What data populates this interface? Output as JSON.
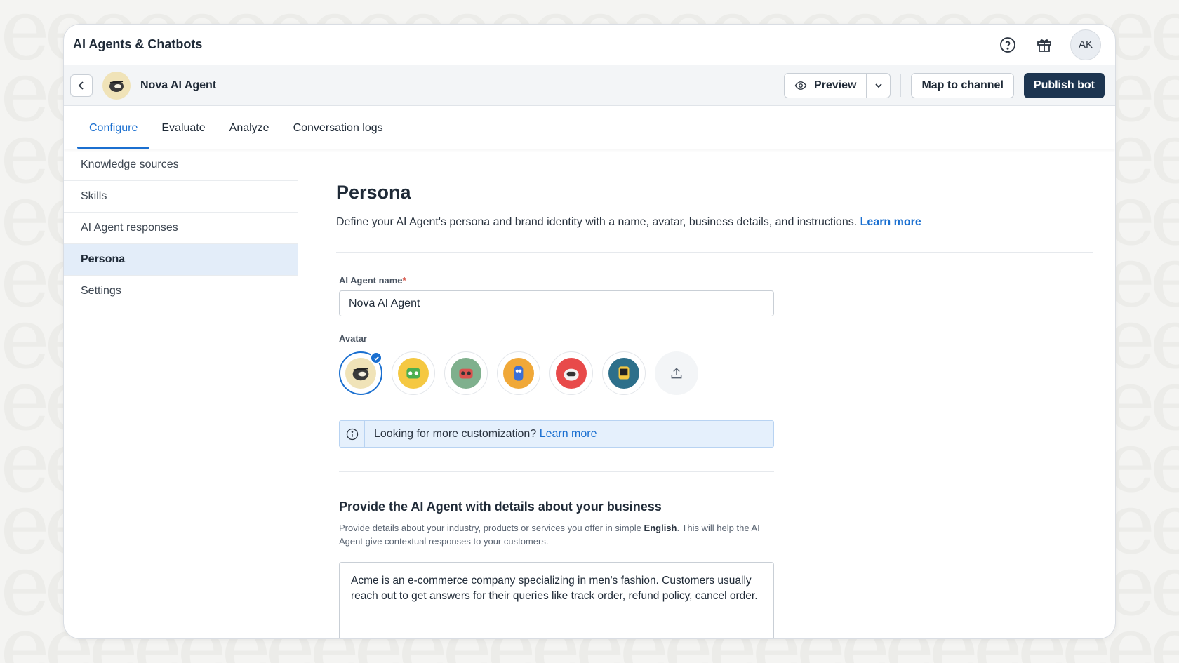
{
  "header": {
    "app_title": "AI Agents & Chatbots",
    "user_initials": "AK"
  },
  "bot": {
    "name": "Nova AI Agent",
    "preview_label": "Preview",
    "map_label": "Map to channel",
    "publish_label": "Publish bot"
  },
  "tabs": [
    {
      "label": "Configure",
      "active": true
    },
    {
      "label": "Evaluate"
    },
    {
      "label": "Analyze"
    },
    {
      "label": "Conversation logs"
    }
  ],
  "sidebar": {
    "items": [
      {
        "label": "Knowledge sources"
      },
      {
        "label": "Skills"
      },
      {
        "label": "AI Agent responses"
      },
      {
        "label": "Persona",
        "active": true
      },
      {
        "label": "Settings"
      }
    ]
  },
  "persona": {
    "title": "Persona",
    "description": "Define your AI Agent's persona and brand identity with a name, avatar, business details, and instructions.",
    "learn_more": "Learn more",
    "name_label": "AI Agent name",
    "required_mark": "*",
    "name_value": "Nova AI Agent",
    "avatar_label": "Avatar",
    "info_text": "Looking for more customization?",
    "info_link": "Learn more",
    "business_title": "Provide the AI Agent with details about your business",
    "business_help_1": "Provide details about your industry, products or services you offer in simple",
    "business_help_bold": "English",
    "business_help_2": ". This will help the AI Agent give contextual responses to your customers.",
    "business_text": "Acme is an e-commerce company specializing in men's fashion. Customers usually reach out to get answers for their queries like track order, refund policy, cancel order."
  },
  "avatars": [
    {
      "icon": "pirate-bot-icon",
      "color": "#f0e3b8",
      "selected": true
    },
    {
      "icon": "green-robot-icon",
      "color": "#f5c842"
    },
    {
      "icon": "red-robot-icon",
      "color": "#7fb08d"
    },
    {
      "icon": "blue-robot-icon",
      "color": "#f0a838"
    },
    {
      "icon": "white-robot-icon",
      "color": "#e84a4a"
    },
    {
      "icon": "monitor-robot-icon",
      "color": "#2d6f8a"
    }
  ],
  "colors": {
    "accent": "#1a6fd0",
    "primary_button": "#1d3550"
  }
}
